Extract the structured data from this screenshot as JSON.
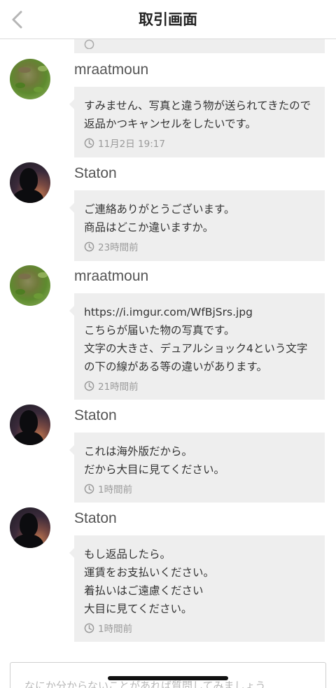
{
  "header": {
    "title": "取引画面",
    "back_icon": "chevron-left-icon"
  },
  "messages": [
    {
      "sender": "mraatmoun",
      "text": "すみません、写真と違う物が送られてきたので返品かつキャンセルをしたいです。",
      "time": "11月2日 19:17"
    },
    {
      "sender": "Staton",
      "text": "ご連絡ありがとうございます。\n商品はどこか違いますか。",
      "time": "23時間前"
    },
    {
      "sender": "mraatmoun",
      "text": "https://i.imgur.com/WfBjSrs.jpg\nこちらが届いた物の写真です。\n文字の大きさ、デュアルショック4という文字の下の線がある等の違いがあります。",
      "time": "21時間前"
    },
    {
      "sender": "Staton",
      "text": "これは海外版だから。\nだから大目に見てください。",
      "time": "1時間前"
    },
    {
      "sender": "Staton",
      "text": "もし返品したら。\n運賃をお支払いください。\n着払いはご遠慮ください\n大目に見てください。",
      "time": "1時間前"
    }
  ],
  "input": {
    "placeholder": "なにか分からないことがあれば質問してみましょう"
  },
  "colors": {
    "bubble": "#eeeeee",
    "time_text": "#9a9a9a",
    "name_text": "#555555"
  }
}
